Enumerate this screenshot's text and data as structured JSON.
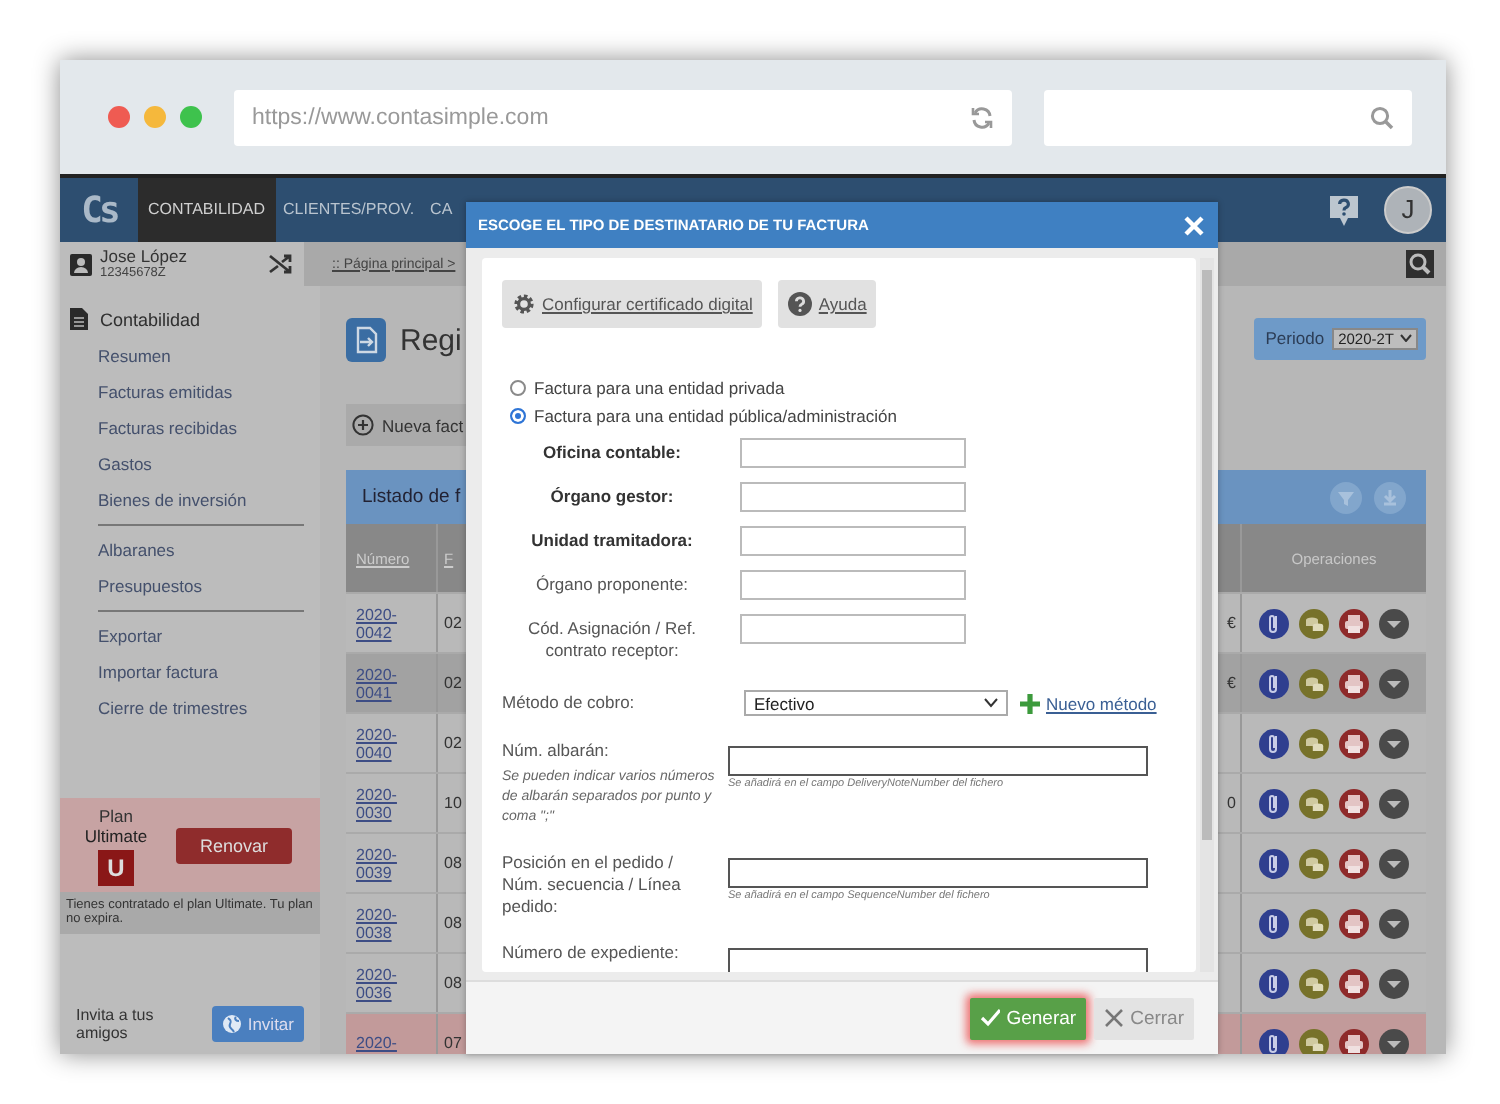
{
  "browser": {
    "url": "https://www.contasimple.com"
  },
  "nav": {
    "logo": "Cs",
    "items": [
      {
        "label": "CONTABILIDAD",
        "selected": true
      },
      {
        "label": "CLIENTES/PROV.",
        "selected": false
      },
      {
        "label": "CA",
        "selected": false
      }
    ],
    "avatar": "J"
  },
  "user": {
    "name": "Jose López",
    "id": "12345678Z"
  },
  "breadcrumb": ":: Página principal >",
  "sidebar": {
    "section": "Contabilidad",
    "groups": [
      [
        {
          "label": "Resumen"
        },
        {
          "label": "Facturas emitidas"
        },
        {
          "label": "Facturas recibidas"
        },
        {
          "label": "Gastos"
        },
        {
          "label": "Bienes de inversión"
        }
      ],
      [
        {
          "label": "Albaranes"
        },
        {
          "label": "Presupuestos"
        }
      ],
      [
        {
          "label": "Exportar"
        },
        {
          "label": "Importar factura"
        },
        {
          "label": "Cierre de trimestres"
        }
      ]
    ]
  },
  "plan": {
    "label": "Plan",
    "name": "Ultimate",
    "badge": "U",
    "button": "Renovar",
    "note": "Tienes contratado el plan Ultimate. Tu plan no expira."
  },
  "invite": {
    "text": "Invita a tus amigos",
    "button": "Invitar"
  },
  "page": {
    "title": "Regi",
    "new_button": "Nueva fact",
    "period_label": "Periodo",
    "period_value": "2020-2T"
  },
  "table": {
    "title": "Listado de f",
    "columns": [
      "Número",
      "F",
      "Operaciones"
    ],
    "rows": [
      {
        "number": "2020-\n0042",
        "column_2": "02",
        "column_3": "€",
        "kind": "normal"
      },
      {
        "number": "2020-\n0041",
        "column_2": "02",
        "column_3": "€",
        "kind": "highlighted"
      },
      {
        "number": "2020-\n0040",
        "column_2": "02",
        "kind": "normal"
      },
      {
        "number": "2020-\n0030",
        "column_2": "10",
        "column_3": "0",
        "kind": "normal"
      },
      {
        "number": "2020-\n0039",
        "column_2": "08",
        "kind": "normal"
      },
      {
        "number": "2020-\n0038",
        "column_2": "08",
        "kind": "normal"
      },
      {
        "number": "2020-\n0036",
        "column_2": "08",
        "kind": "normal"
      },
      {
        "number": "2020-",
        "column_2": "07",
        "kind": "overdue"
      }
    ]
  },
  "modal": {
    "title": "ESCOGE EL TIPO DE DESTINATARIO DE TU FACTURA",
    "tools": [
      {
        "label": "Configurar certificado digital",
        "kind": "gear"
      },
      {
        "label": "Ayuda",
        "kind": "help"
      }
    ],
    "radios": [
      {
        "label": "Factura para una entidad privada",
        "selected": false
      },
      {
        "label": "Factura para una entidad pública/administración",
        "selected": true
      }
    ],
    "entity_fields": [
      {
        "label": "Oficina contable:",
        "required": true
      },
      {
        "label": "Órgano gestor:",
        "required": true
      },
      {
        "label": "Unidad tramitadora:",
        "required": true
      },
      {
        "label": "Órgano proponente:",
        "required": false
      },
      {
        "label": "Cód. Asignación / Ref. contrato receptor:",
        "required": false
      }
    ],
    "payment": {
      "label": "Método de cobro:",
      "value": "Efectivo",
      "link": "Nuevo método"
    },
    "extra_fields": [
      {
        "label": "Núm. albarán:",
        "hint": "Se pueden indicar varios números de albarán separados por punto y coma \";\"",
        "note": "Se añadirá en el campo DeliveryNoteNumber del fichero"
      },
      {
        "label": "Posición en el pedido / Núm. secuencia / Línea pedido:",
        "note": "Se añadirá en el campo SequenceNumber del fichero"
      },
      {
        "label": "Número de expediente:"
      }
    ],
    "buttons": [
      {
        "label": "Generar",
        "kind": "primary"
      },
      {
        "label": "Cerrar",
        "kind": "secondary"
      }
    ]
  }
}
